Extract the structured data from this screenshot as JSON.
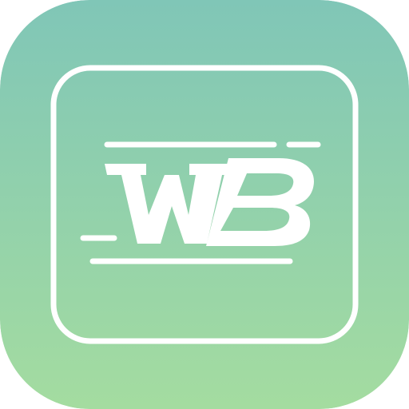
{
  "app_icon": {
    "logo_text": "WB",
    "colors": {
      "gradient_top": "#80c6b7",
      "gradient_bottom": "#a4dca0",
      "foreground": "#ffffff"
    }
  }
}
